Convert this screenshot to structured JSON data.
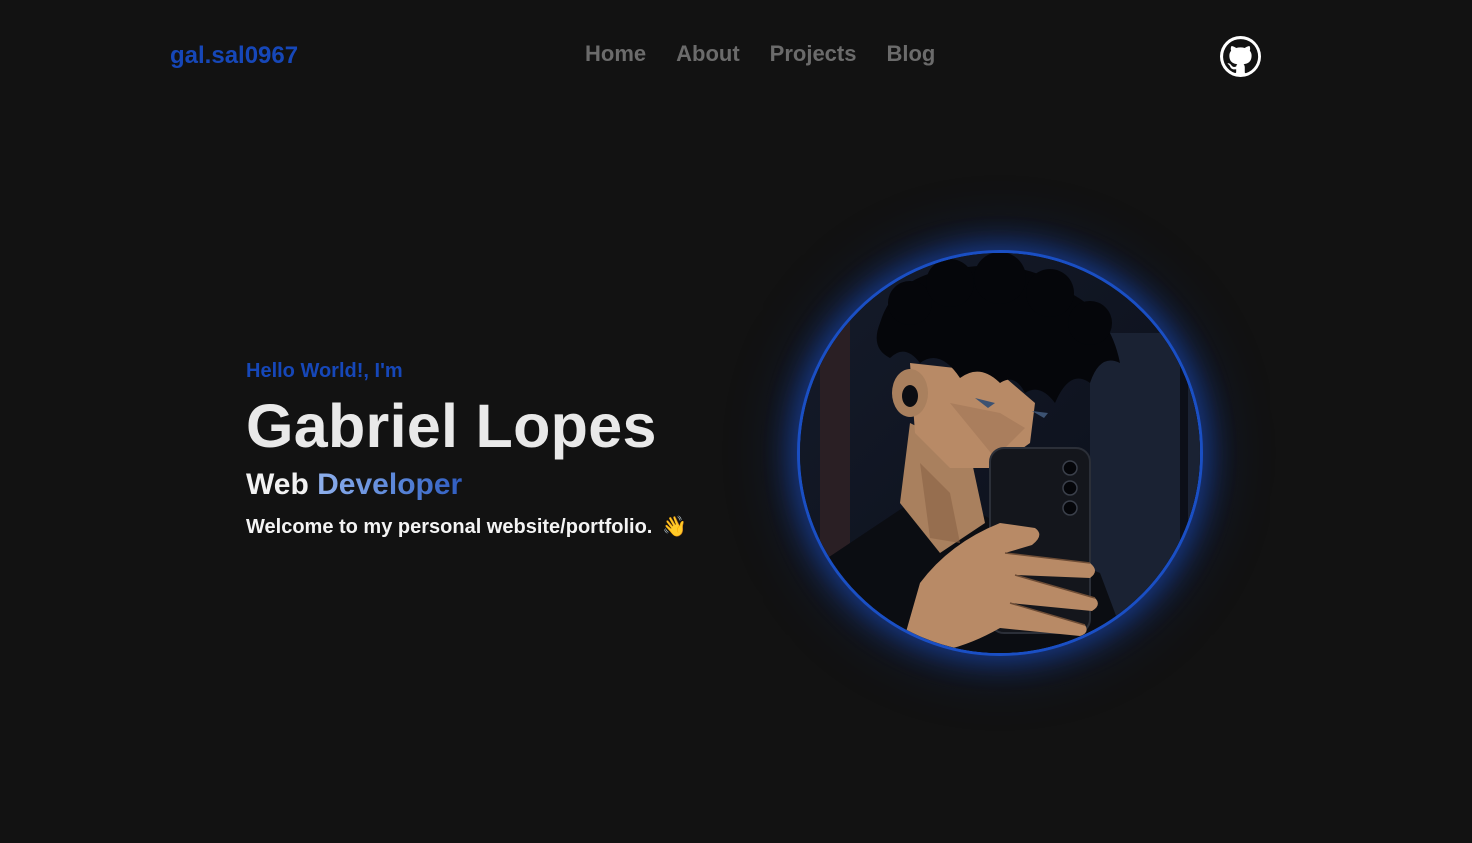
{
  "header": {
    "brand": "gal.sal0967",
    "nav": [
      {
        "label": "Home"
      },
      {
        "label": "About"
      },
      {
        "label": "Projects"
      },
      {
        "label": "Blog"
      }
    ],
    "github_icon": "github-icon"
  },
  "hero": {
    "greeting": "Hello World!, I'm",
    "name": "Gabriel Lopes",
    "role_prefix": "Web",
    "role_accent": "Developer",
    "welcome": "Welcome to my personal website/portfolio.",
    "welcome_emoji": "👋"
  },
  "colors": {
    "background": "#121212",
    "accent": "#1647b8",
    "nav_text": "#6b6b6b",
    "heading": "#e9e9e9"
  }
}
